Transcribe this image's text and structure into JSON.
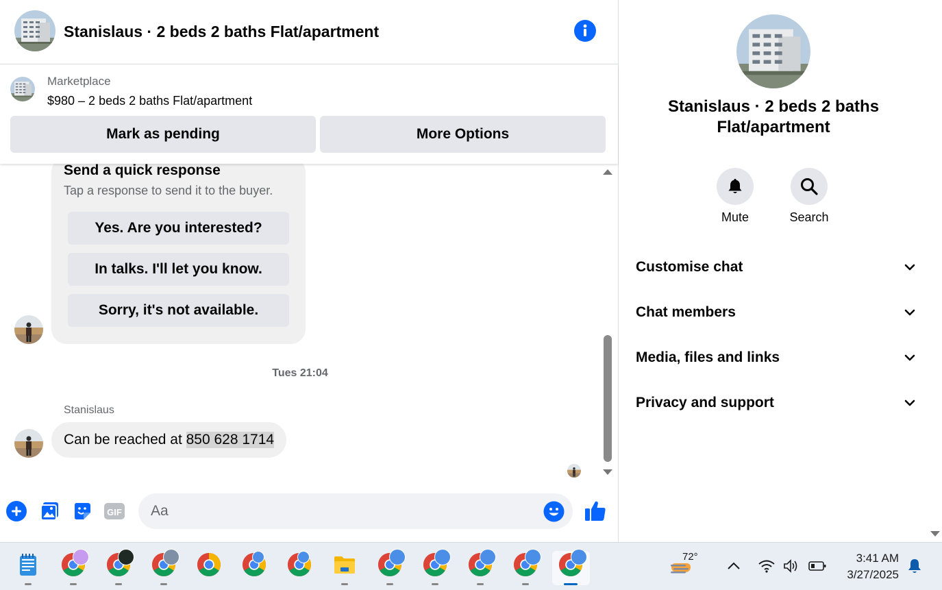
{
  "chat": {
    "title": "Stanislaus · 2 beds 2 baths Flat/apartment",
    "listing": {
      "source": "Marketplace",
      "description": "$980 – 2 beds 2 baths Flat/apartment",
      "mark_pending_label": "Mark as pending",
      "more_options_label": "More Options"
    },
    "quick_response": {
      "title": "Send a quick response",
      "subtitle": "Tap a response to send it to the buyer.",
      "options": [
        "Yes. Are you interested?",
        "In talks. I'll let you know.",
        "Sorry, it's not available."
      ]
    },
    "timestamp": "Tues 21:04",
    "last_message": {
      "sender": "Stanislaus",
      "text_prefix": "Can be reached at ",
      "phone": "850 628 1714"
    },
    "composer": {
      "placeholder": "Aa",
      "icons": [
        "plus-icon",
        "photo-icon",
        "sticker-icon",
        "gif-icon",
        "emoji-icon",
        "thumbs-up-icon"
      ],
      "gif_label": "GIF"
    }
  },
  "details": {
    "title": "Stanislaus · 2 beds 2 baths Flat/apartment",
    "actions": [
      {
        "label": "Mute",
        "icon": "bell-icon"
      },
      {
        "label": "Search",
        "icon": "search-icon"
      }
    ],
    "sections": [
      "Customise chat",
      "Chat members",
      "Media, files and links",
      "Privacy and support"
    ]
  },
  "taskbar": {
    "apps": [
      "notepad",
      "chrome",
      "chrome",
      "chrome",
      "chrome",
      "chrome",
      "chrome",
      "file-explorer",
      "chrome",
      "chrome",
      "chrome",
      "chrome",
      "chrome"
    ],
    "weather": "72°",
    "time": "3:41 AM",
    "date": "3/27/2025"
  },
  "colors": {
    "accent": "#0866ff",
    "bubble": "#f0f0f0",
    "button": "#e4e6eb",
    "muted_text": "#65676b",
    "taskbar": "#e9eef4"
  }
}
